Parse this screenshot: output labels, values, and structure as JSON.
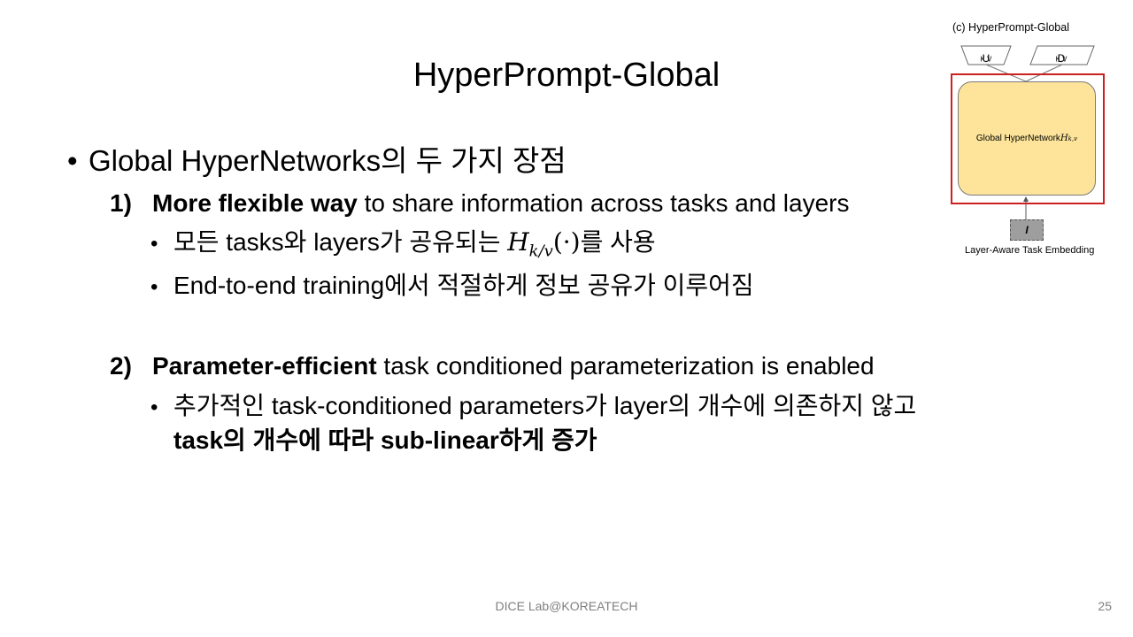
{
  "slide": {
    "title": "HyperPrompt-Global",
    "bullet": "Global HyperNetworks의 두 가지 장점",
    "items": [
      {
        "number": "1)",
        "bold": "More flexible way",
        "rest": " to share information across tasks and layers",
        "subs": [
          {
            "before": "모든 tasks와 layers가 공유되는 ",
            "math": "H",
            "math_sub": "k/v",
            "math_arg": "(·)",
            "after": "를 사용"
          },
          {
            "text": "End-to-end training에서 적절하게 정보 공유가 이루어짐"
          }
        ]
      },
      {
        "number": "2)",
        "bold": "Parameter-efficient",
        "rest": " task conditioned parameterization is enabled",
        "subs": [
          {
            "line1": "추가적인 task-conditioned parameters가 layer의 개수에 의존하지 않고",
            "line2": "task의 개수에 따라 sub-linear하게 증가"
          }
        ]
      }
    ]
  },
  "diagram": {
    "caption": "(c) HyperPrompt-Global",
    "u_label": "U",
    "u_sub": "K,V",
    "d_label": "D",
    "d_sub": "K,V",
    "network_label": "Global HyperNetwork ",
    "network_symbol": "H",
    "network_sub": "k,v",
    "embedding_symbol": "I",
    "embedding_caption": "Layer-Aware Task Embedding",
    "highlight_color": "#cc1f1f",
    "network_color": "#fde49a"
  },
  "footer": {
    "lab": "DICE  Lab@KOREATECH",
    "page": "25"
  }
}
